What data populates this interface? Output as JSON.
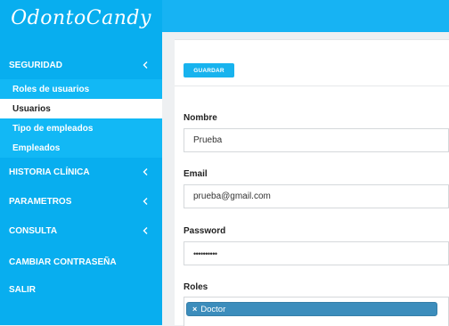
{
  "app": {
    "logo_text": "OdontoCandy"
  },
  "sidebar": {
    "items": [
      {
        "label": "SEGURIDAD",
        "has_chevron": true
      },
      {
        "label": "HISTORIA CLÍNICA",
        "has_chevron": true
      },
      {
        "label": "PARAMETROS",
        "has_chevron": true
      },
      {
        "label": "CONSULTA",
        "has_chevron": true
      },
      {
        "label": "CAMBIAR CONTRASEÑA",
        "has_chevron": false
      },
      {
        "label": "SALIR",
        "has_chevron": false
      }
    ],
    "subitems": [
      {
        "label": "Roles de usuarios",
        "active": false
      },
      {
        "label": "Usuarios",
        "active": true
      },
      {
        "label": "Tipo de empleados",
        "active": false
      },
      {
        "label": "Empleados",
        "active": false
      }
    ]
  },
  "form": {
    "save_label": "GUARDAR",
    "nombre": {
      "label": "Nombre",
      "value": "Prueba"
    },
    "email": {
      "label": "Email",
      "value": "prueba@gmail.com"
    },
    "password": {
      "label": "Password",
      "value": "••••••••••"
    },
    "roles": {
      "label": "Roles",
      "tags": [
        {
          "remove": "×",
          "label": "Doctor"
        }
      ]
    }
  },
  "colors": {
    "sidebar": "#08aeef",
    "topbar": "#17b3f3",
    "accent": "#18b3ee",
    "tag": "#3c8dbc"
  },
  "icons": {
    "chevron": "chevron-left-icon",
    "tag_remove": "close-icon"
  }
}
